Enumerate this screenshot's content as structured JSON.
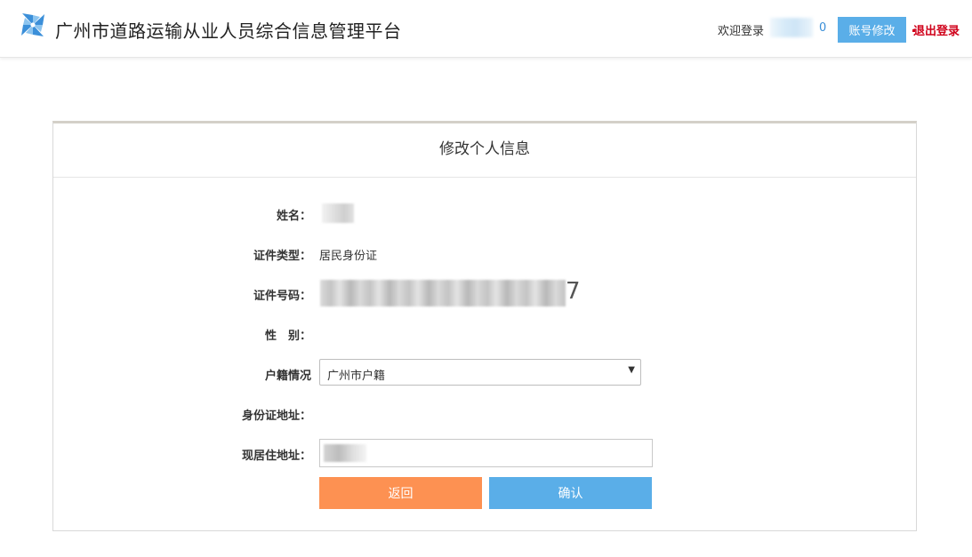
{
  "header": {
    "title": "广州市道路运输从业人员综合信息管理平台",
    "welcome": "欢迎登录",
    "user_suffix": "0",
    "account_button": "账号修改",
    "logout": "退出登录"
  },
  "form": {
    "title": "修改个人信息",
    "fields": {
      "name_label": "姓名：",
      "id_type_label": "证件类型：",
      "id_type_value": "居民身份证",
      "id_number_label": "证件号码：",
      "id_number_tail": "7",
      "gender_label": "性　别：",
      "household_label": "户籍情况",
      "household_value": "广州市户籍",
      "id_address_label": "身份证地址：",
      "current_address_label": "现居住地址："
    },
    "buttons": {
      "back": "返回",
      "confirm": "确认"
    }
  },
  "colors": {
    "primary": "#5aaee8",
    "warning": "#fd9152",
    "logout": "#d0021b",
    "logo": "#3b8fd9"
  },
  "icons": {
    "logo": "pinwheel-logo-icon",
    "select_arrow": "dropdown-arrow-icon"
  }
}
